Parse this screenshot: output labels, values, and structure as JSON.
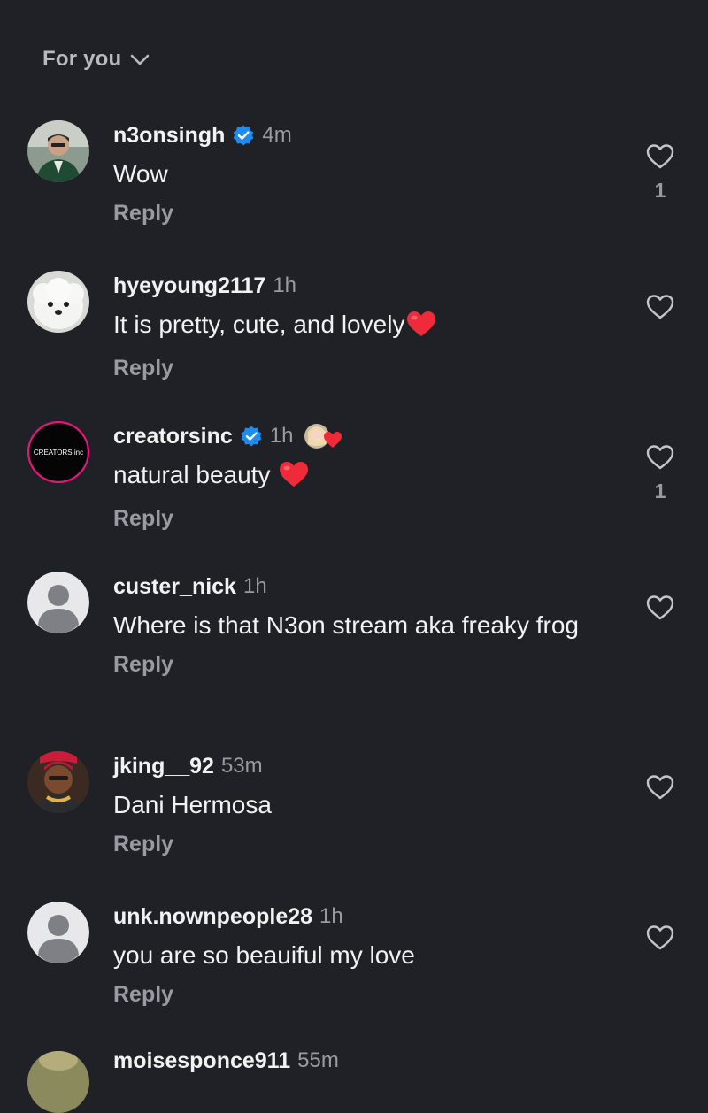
{
  "header": {
    "sort_label": "For you"
  },
  "icons": {
    "like": "heart-outline-icon",
    "sort": "chevron-down-icon",
    "verified": "verified-badge-icon"
  },
  "colors": {
    "background": "#202126",
    "verified": "#1d8cf0",
    "heart_emoji": "#ef2b3a",
    "muted_text": "#9a9ba2"
  },
  "comments": [
    {
      "username": "n3onsingh",
      "verified": true,
      "time": "4m",
      "text": "Wow",
      "reply": "Reply",
      "likes": "1"
    },
    {
      "username": "hyeyoung2117",
      "verified": false,
      "time": "1h",
      "text": "It is pretty, cute, and lovely",
      "reply": "Reply",
      "likes": ""
    },
    {
      "username": "creatorsinc",
      "verified": true,
      "time": "1h",
      "text": "natural beauty",
      "reply": "Reply",
      "likes": "1",
      "avatar_text": "CREATORS inc"
    },
    {
      "username": "custer_nick",
      "verified": false,
      "time": "1h",
      "text": "Where is that N3on stream aka freaky frog",
      "reply": "Reply",
      "likes": ""
    },
    {
      "username": "jking__92",
      "verified": false,
      "time": "53m",
      "text": "Dani Hermosa",
      "reply": "Reply",
      "likes": ""
    },
    {
      "username": "unk.nownpeople28",
      "verified": false,
      "time": "1h",
      "text": "you are so beauiful my love",
      "reply": "Reply",
      "likes": ""
    },
    {
      "username": "moisesponce911",
      "verified": false,
      "time": "55m"
    }
  ]
}
